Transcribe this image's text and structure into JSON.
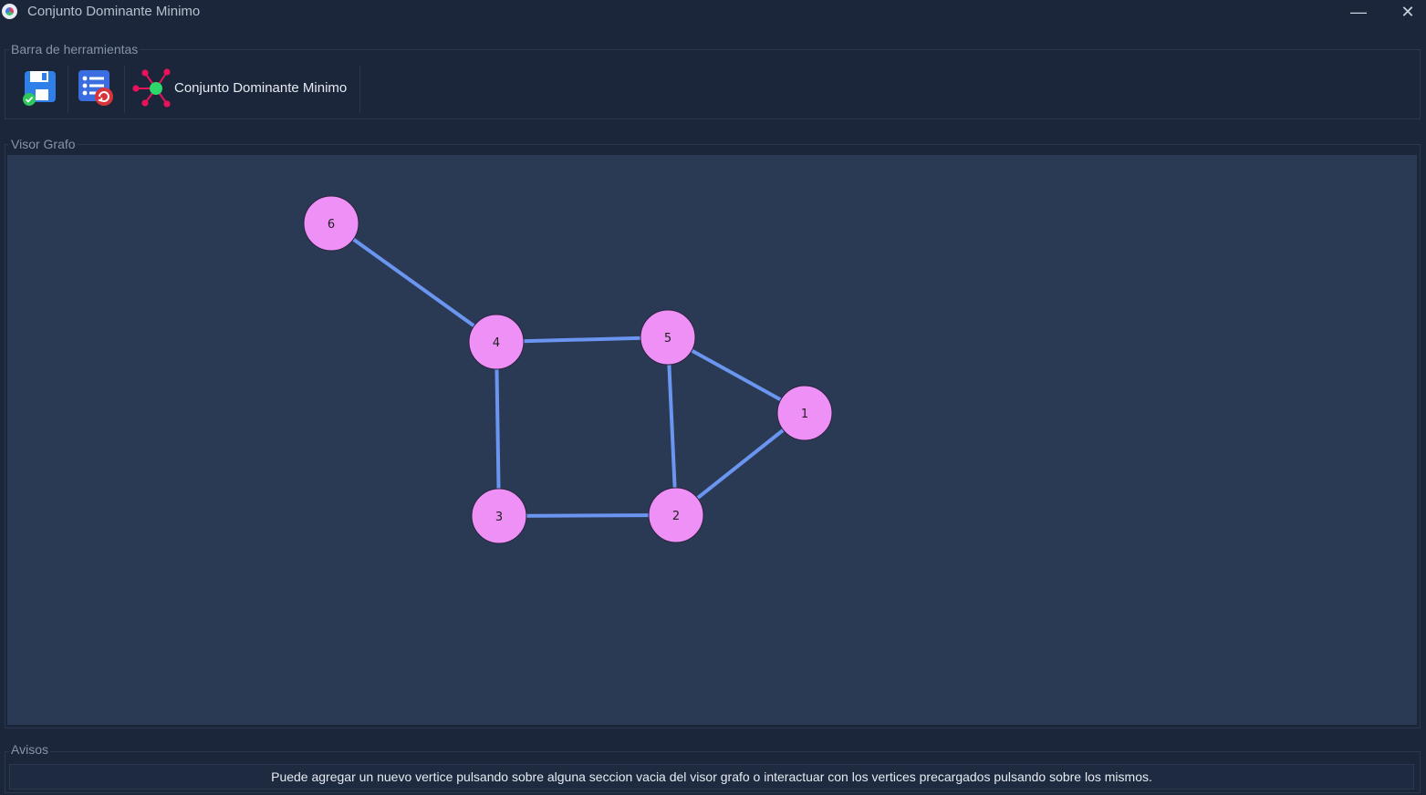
{
  "window": {
    "title": "Conjunto Dominante Minimo",
    "minimize_glyph": "—",
    "close_glyph": "✕"
  },
  "toolbar": {
    "group_label": "Barra de herramientas",
    "buttons": [
      {
        "icon": "save-icon"
      },
      {
        "icon": "reload-list-icon"
      },
      {
        "icon": "graph-network-icon",
        "label": "Conjunto Dominante Minimo"
      }
    ]
  },
  "viewer": {
    "group_label": "Visor Grafo",
    "colors": {
      "background": "#2a3a55",
      "node_fill": "#ee90f5",
      "edge": "#6a95f0"
    },
    "nodes": [
      {
        "id": "6",
        "label": "6"
      },
      {
        "id": "4",
        "label": "4"
      },
      {
        "id": "5",
        "label": "5"
      },
      {
        "id": "1",
        "label": "1"
      },
      {
        "id": "3",
        "label": "3"
      },
      {
        "id": "2",
        "label": "2"
      }
    ],
    "edges": [
      [
        "6",
        "4"
      ],
      [
        "4",
        "5"
      ],
      [
        "4",
        "3"
      ],
      [
        "5",
        "1"
      ],
      [
        "5",
        "2"
      ],
      [
        "1",
        "2"
      ],
      [
        "3",
        "2"
      ]
    ]
  },
  "avisos": {
    "group_label": "Avisos",
    "message": "Puede agregar un nuevo vertice pulsando sobre alguna seccion vacia del visor grafo o interactuar con los vertices precargados pulsando sobre los mismos."
  }
}
